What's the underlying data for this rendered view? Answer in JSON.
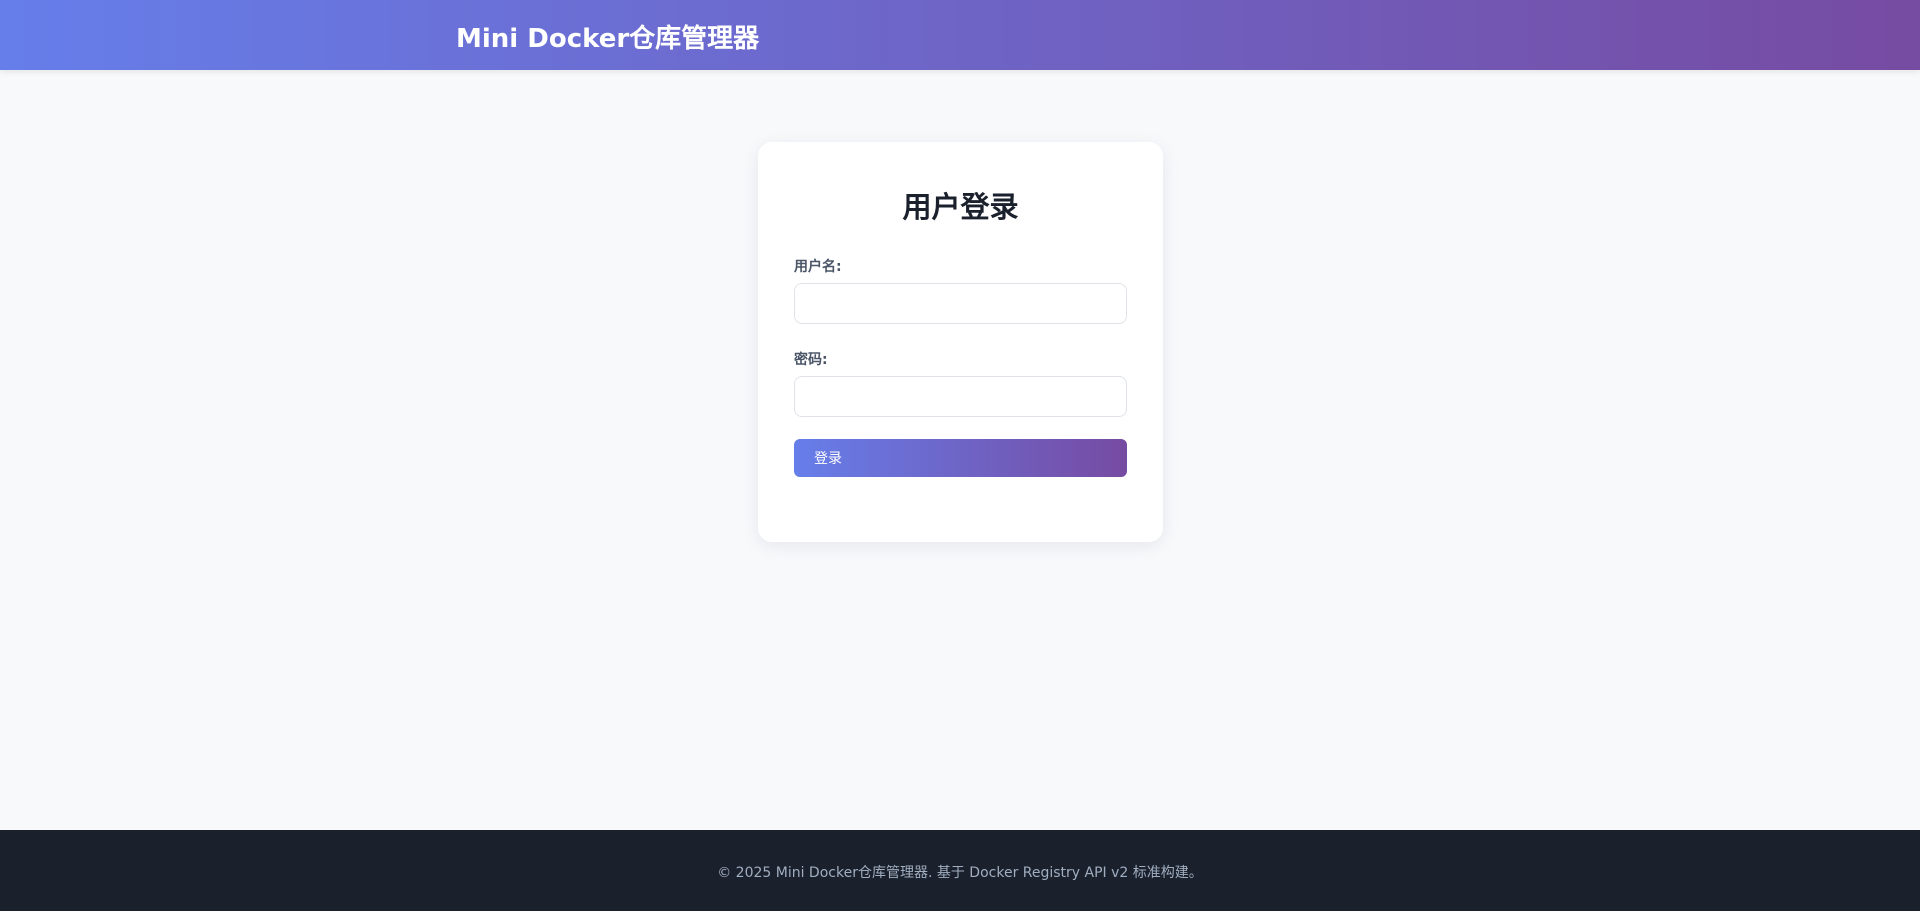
{
  "header": {
    "title": "Mini Docker仓库管理器"
  },
  "login": {
    "title": "用户登录",
    "username_label": "用户名:",
    "username_value": "",
    "password_label": "密码:",
    "password_value": "",
    "submit_label": "登录"
  },
  "footer": {
    "text": "© 2025 Mini Docker仓库管理器. 基于 Docker Registry API v2 标准构建。"
  },
  "colors": {
    "gradient_start": "#667eea",
    "gradient_end": "#764ba2",
    "footer_bg": "#1a202c",
    "page_bg": "#f8f9fb"
  }
}
